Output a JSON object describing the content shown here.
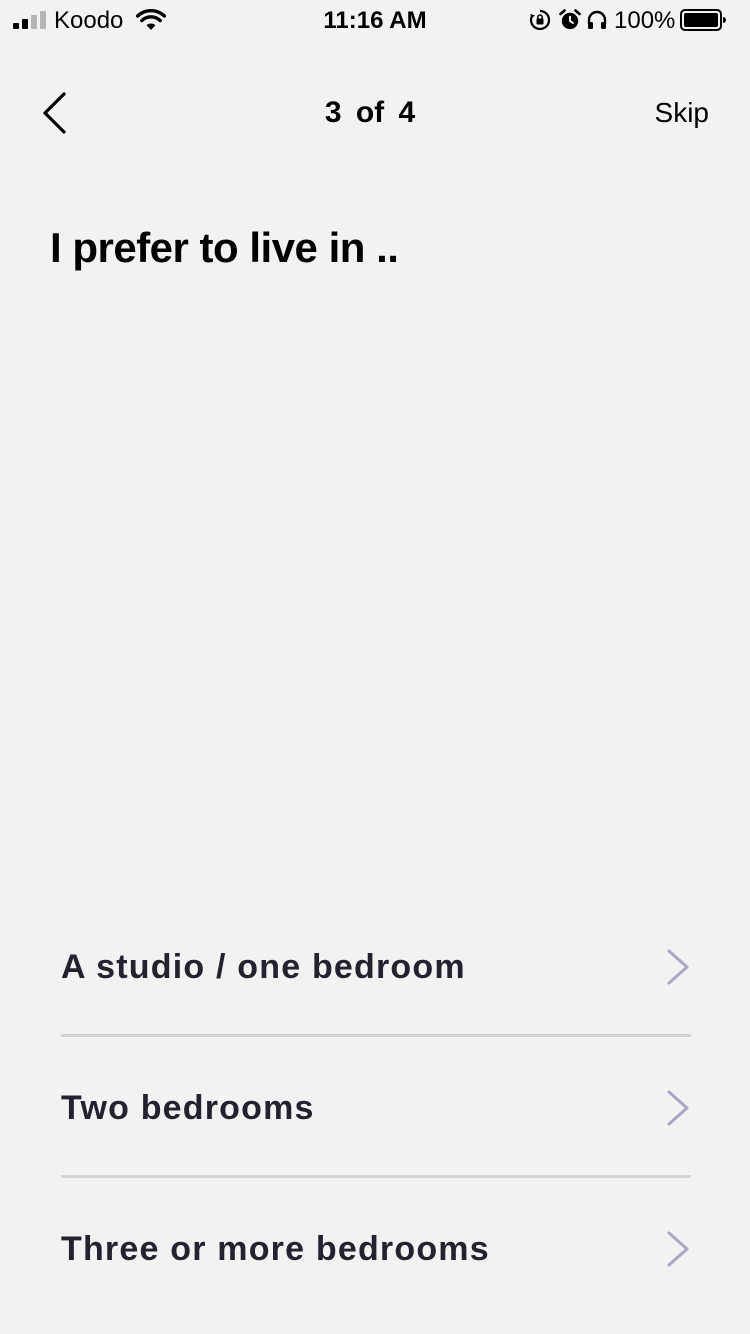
{
  "status_bar": {
    "carrier": "Koodo",
    "time": "11:16 AM",
    "battery": "100%",
    "icons": [
      "signal-icon",
      "wifi-icon",
      "orientation-lock-icon",
      "alarm-icon",
      "headphones-icon",
      "battery-icon"
    ]
  },
  "nav": {
    "back_icon": "chevron-left-icon",
    "step": "3 of 4",
    "skip_label": "Skip"
  },
  "question": "I prefer to live in ..",
  "options": [
    {
      "label": "A studio / one bedroom",
      "icon": "chevron-right-icon"
    },
    {
      "label": "Two bedrooms",
      "icon": "chevron-right-icon"
    },
    {
      "label": "Three or more bedrooms",
      "icon": "chevron-right-icon"
    }
  ],
  "colors": {
    "background": "#f2f2f2",
    "option_text": "#23232f",
    "chevron": "#a7a7c4",
    "divider": "#d3d3d6"
  }
}
